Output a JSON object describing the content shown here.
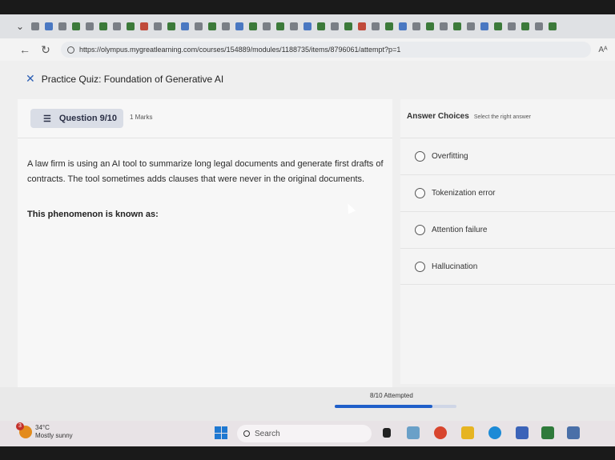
{
  "browser": {
    "url": "https://olympus.mygreatlearning.com/courses/154889/modules/1188735/items/8796061/attempt?p=1",
    "reader_label": "Aᴬ"
  },
  "quiz": {
    "title": "Practice Quiz: Foundation of Generative AI",
    "question_label": "Question 9/10",
    "marks": "1 Marks",
    "question_text": "A law firm is using an AI tool to summarize long legal documents and generate first drafts of contracts. The tool sometimes adds clauses that were never in the original documents.",
    "prompt": "This phenomenon is known as:",
    "answer_heading": "Answer Choices",
    "answer_hint": "Select the right answer",
    "options": [
      {
        "label": "Overfitting"
      },
      {
        "label": "Tokenization error"
      },
      {
        "label": "Attention failure"
      },
      {
        "label": "Hallucination"
      }
    ],
    "progress_text": "8/10 Attempted",
    "progress_fraction": 0.8
  },
  "taskbar": {
    "temperature": "34°C",
    "condition": "Mostly sunny",
    "weather_badge": "3",
    "search_placeholder": "Search"
  },
  "colors": {
    "accent": "#1f5fc9"
  }
}
